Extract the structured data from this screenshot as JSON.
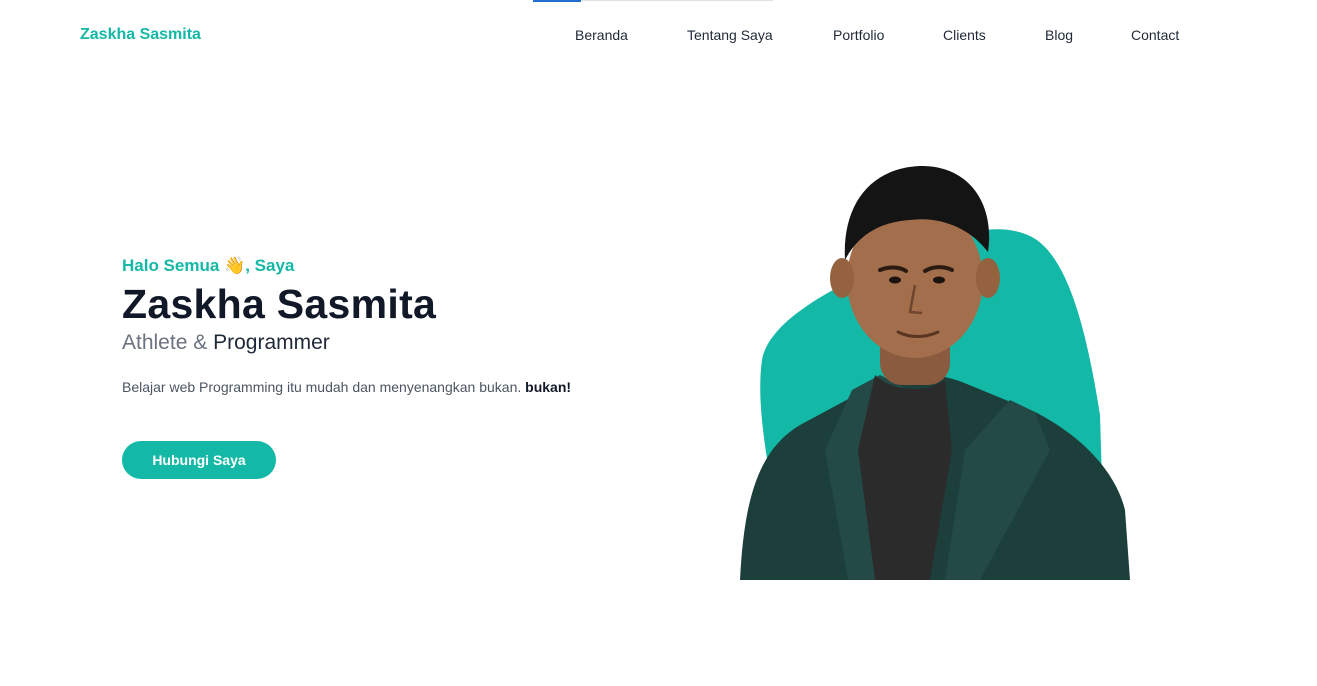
{
  "brand": {
    "title": "Zaskha Sasmita"
  },
  "nav": {
    "items": [
      "Beranda",
      "Tentang Saya",
      "Portfolio",
      "Clients",
      "Blog",
      "Contact"
    ]
  },
  "hero": {
    "greeting_prefix": "Halo Semua",
    "greeting_suffix": ", Saya",
    "wave_emoji": "👋",
    "name": "Zaskha Sasmita",
    "role_a": "Athlete",
    "role_amp": "&",
    "role_b": "Programmer",
    "tagline": "Belajar web Programming itu mudah dan menyenangkan bukan.",
    "tagline_bold": "bukan!",
    "cta_label": "Hubungi Saya"
  },
  "colors": {
    "accent": "#14b8a6",
    "heading": "#111827",
    "muted": "#6b7280",
    "nav_active": "#1f6fd1"
  },
  "icons": {
    "wave": "waving-hand-icon"
  }
}
